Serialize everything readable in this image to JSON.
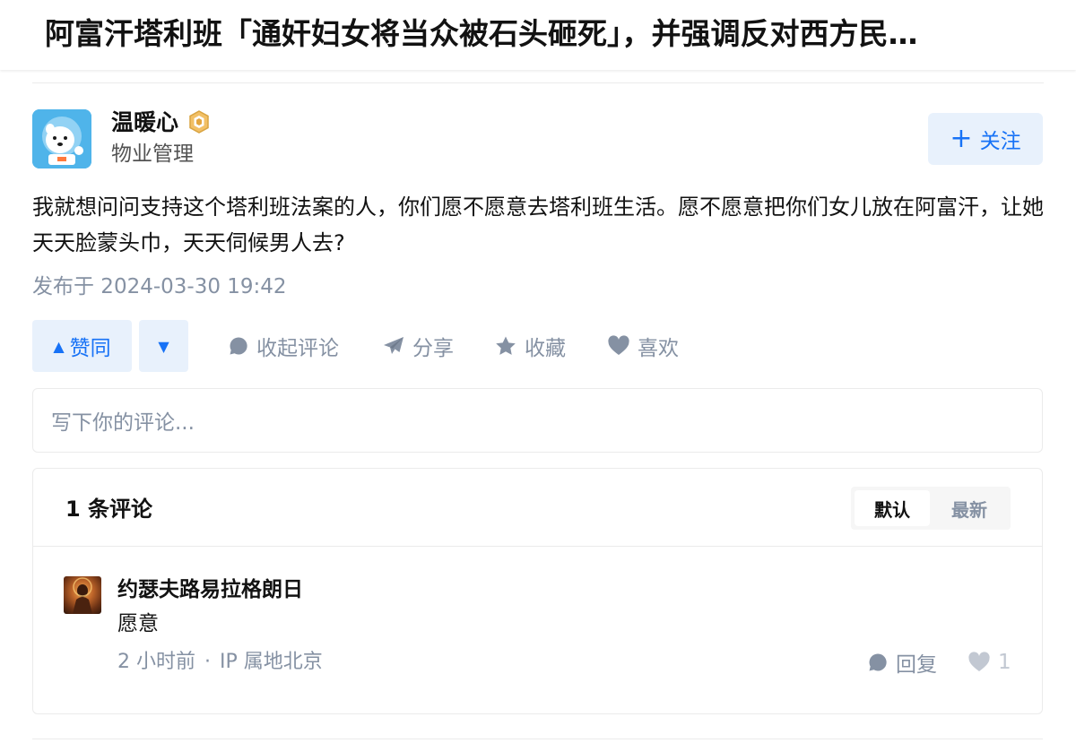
{
  "header": {
    "title": "阿富汗塔利班「通奸妇女将当众被石头砸死」，并强调反对西方民…"
  },
  "answer": {
    "author": {
      "name": "温暖心",
      "bio": "物业管理",
      "avatar_icon": "cartoon-bear-astronaut-avatar",
      "badge_icon": "gold-badge-icon"
    },
    "follow_button": {
      "plus": "+",
      "label": "关注"
    },
    "content": "我就想问问支持这个塔利班法案的人，你们愿不愿意去塔利班生活。愿不愿意把你们女儿放在阿富汗，让她天天脸蒙头巾，天天伺候男人去?",
    "published": "发布于 2024-03-30 19:42",
    "actions": {
      "upvote_arrow": "▲",
      "upvote_label": "赞同",
      "downvote_arrow": "▼",
      "collapse_comments_label": "收起评论",
      "share_label": "分享",
      "collect_label": "收藏",
      "like_label": "喜欢"
    }
  },
  "comment_input": {
    "placeholder": "写下你的评论..."
  },
  "comments": {
    "count_label": "1 条评论",
    "sort": {
      "default_label": "默认",
      "latest_label": "最新",
      "active": "默认"
    },
    "items": [
      {
        "author": "约瑟夫路易拉格朗日",
        "text": "愿意",
        "time": "2 小时前",
        "separator": "·",
        "location": "IP 属地北京",
        "reply_label": "回复",
        "likes": "1"
      }
    ]
  },
  "colors": {
    "accent": "#1772f6",
    "accent_bg": "#e8f1fc",
    "muted_text": "#8591a3",
    "border": "#ebebeb"
  }
}
